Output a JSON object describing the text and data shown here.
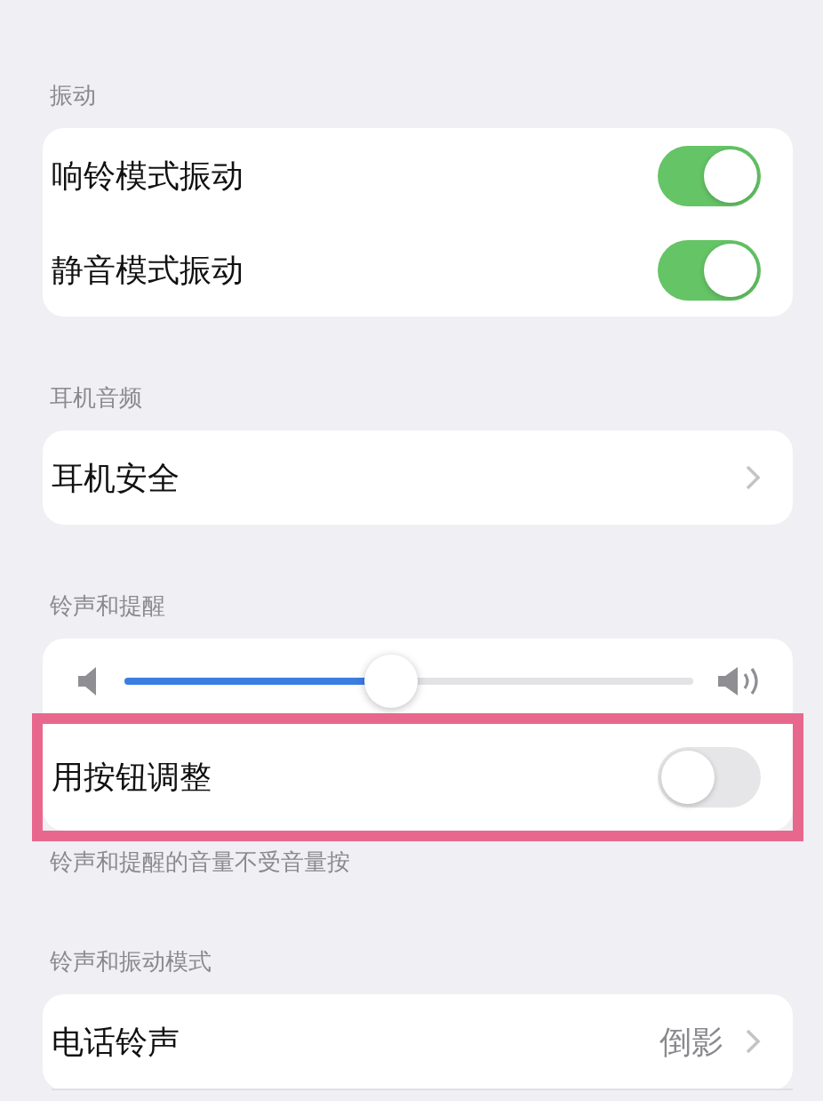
{
  "sections": [
    {
      "header": "振动",
      "rows": [
        {
          "kind": "toggle",
          "label": "响铃模式振动",
          "on": true
        },
        {
          "kind": "toggle",
          "label": "静音模式振动",
          "on": true
        }
      ]
    },
    {
      "header": "耳机音频",
      "rows": [
        {
          "kind": "link",
          "label": "耳机安全"
        }
      ]
    },
    {
      "header": "铃声和提醒",
      "rows": [
        {
          "kind": "slider",
          "level": 0.47
        },
        {
          "kind": "toggle",
          "label": "用按钮调整",
          "on": false,
          "highlighted": true
        }
      ],
      "footer": "铃声和提醒的音量不受音量按"
    },
    {
      "header": "铃声和振动模式",
      "rows": [
        {
          "kind": "link",
          "label": "电话铃声",
          "value": "倒影"
        }
      ]
    }
  ]
}
